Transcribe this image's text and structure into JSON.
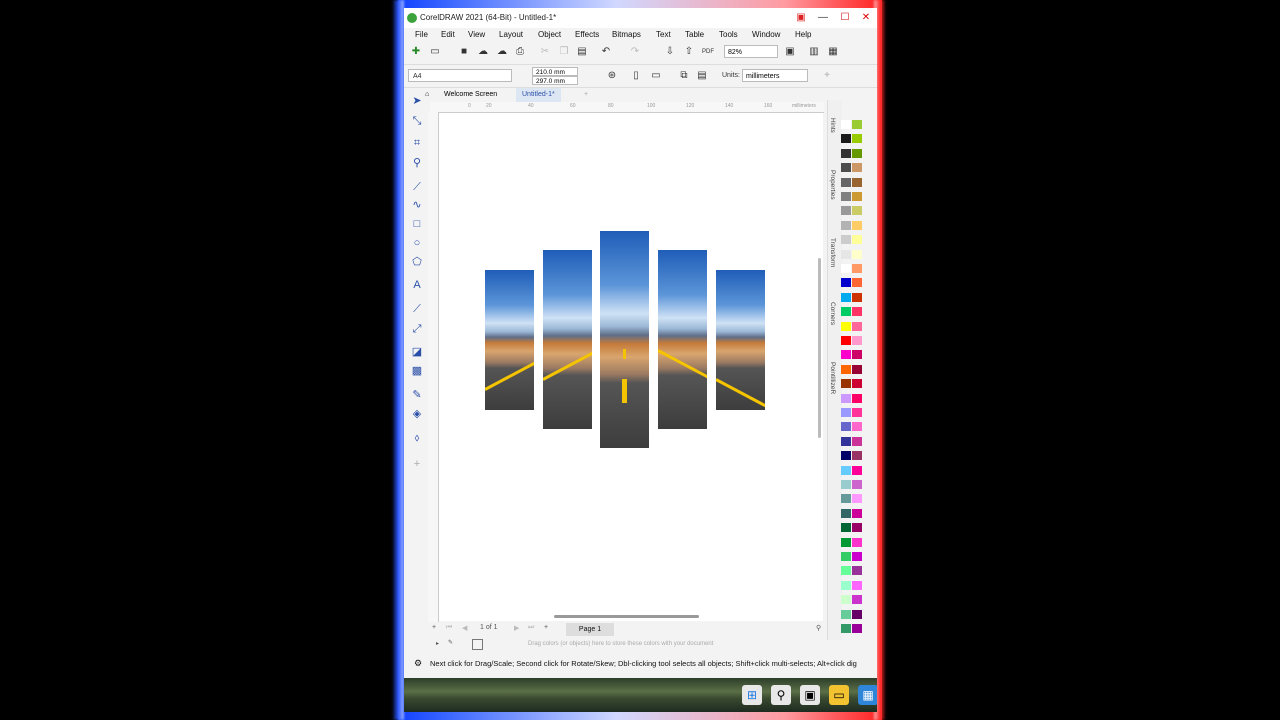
{
  "window": {
    "title": "CorelDRAW 2021 (64-Bit) - Untitled-1*",
    "controls": [
      "—",
      "☐",
      "✕"
    ]
  },
  "menu": [
    "File",
    "Edit",
    "View",
    "Layout",
    "Object",
    "Effects",
    "Bitmaps",
    "Text",
    "Table",
    "Tools",
    "Window",
    "Help"
  ],
  "toolbar": {
    "zoom": "82%"
  },
  "property_bar": {
    "page_size": "A4",
    "width": "210.0 mm",
    "height": "297.0 mm",
    "units_label": "Units:",
    "units_value": "millimeters"
  },
  "tabs": [
    {
      "label": "Welcome Screen",
      "active": false
    },
    {
      "label": "Untitled-1*",
      "active": true
    }
  ],
  "ruler": {
    "unit": "millimeters",
    "ticks": [
      "0",
      "20",
      "40",
      "60",
      "80",
      "100",
      "120",
      "140",
      "160",
      "180"
    ]
  },
  "canvas": {
    "image_description_icon": "road-image",
    "panels": 5
  },
  "pagebar": {
    "counter": "1 of 1",
    "page_tab": "Page 1"
  },
  "colorbar": {
    "hint": "Drag colors (or objects) here to store these colors with your document"
  },
  "dockers": [
    "Hints",
    "Properties",
    "Transform",
    "Corners",
    "PointillizeR"
  ],
  "status": {
    "text": "Next click for Drag/Scale; Second click for Rotate/Skew; Dbl-clicking tool selects all objects; Shift+click multi-selects; Alt+click dig"
  },
  "palette_colors": {
    "col1": [
      "#ffffff",
      "#1a1a1a",
      "#333333",
      "#4d4d4d",
      "#666666",
      "#808080",
      "#999999",
      "#b3b3b3",
      "#cccccc",
      "#e6e6e6",
      "#ffffff",
      "#0000cc",
      "#00aaee",
      "#00cc66",
      "#ffff00",
      "#ff0000",
      "#ff00cc",
      "#ff6600",
      "#993300",
      "#cc99ff",
      "#9999ff",
      "#6666cc",
      "#333399",
      "#000066",
      "#66ccff",
      "#99cccc",
      "#669999",
      "#336666",
      "#006633",
      "#009933",
      "#33cc66",
      "#66ff99",
      "#99ffcc",
      "#ccffcc",
      "#66cc99",
      "#339966"
    ],
    "col2": [
      "#99cc33",
      "#99cc00",
      "#669900",
      "#cc9966",
      "#996633",
      "#cc9933",
      "#cccc66",
      "#ffcc66",
      "#ffff99",
      "#ffffcc",
      "#ff9966",
      "#ff6633",
      "#cc3300",
      "#ff3366",
      "#ff6699",
      "#ff99cc",
      "#cc0066",
      "#990033",
      "#cc0033",
      "#ff0066",
      "#ff3399",
      "#ff66cc",
      "#cc3399",
      "#993366",
      "#ff0099",
      "#cc66cc",
      "#ff99ff",
      "#cc0099",
      "#990066",
      "#ff33cc",
      "#cc00cc",
      "#993399",
      "#ff66ff",
      "#cc33cc",
      "#660066",
      "#990099"
    ]
  }
}
